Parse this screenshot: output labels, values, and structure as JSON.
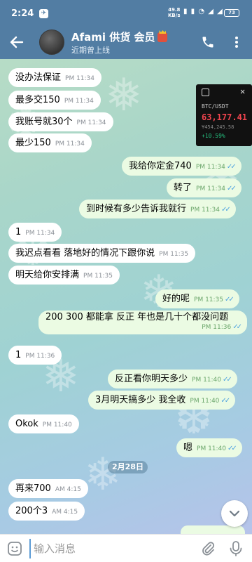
{
  "status_bar": {
    "time": "2:24",
    "telegram_badge": "✈",
    "speed_value": "49.8",
    "speed_unit": "KB/s",
    "signal_icons": "▮ ▮ ◔ ◢ ◢",
    "battery": "73"
  },
  "header": {
    "title": "Afami 供货 会员",
    "subtitle": "近期曾上线",
    "back_icon": "arrow-left",
    "call_icon": "phone",
    "menu_icon": "more-vertical"
  },
  "btc_widget": {
    "pair": "BTC/USDT",
    "price": "63,177.41",
    "local_price": "¥454,245.58",
    "change": "+10.59%",
    "close_label": "✕"
  },
  "messages": [
    {
      "text": "没办法保证",
      "time": "PM 11:34",
      "dir": "in"
    },
    {
      "text": "最多交150",
      "time": "PM 11:34",
      "dir": "in"
    },
    {
      "text": "我账号就30个",
      "time": "PM 11:34",
      "dir": "in"
    },
    {
      "text": "最少150",
      "time": "PM 11:34",
      "dir": "in"
    },
    {
      "text": "我给你定金740",
      "time": "PM 11:34",
      "dir": "out"
    },
    {
      "text": "转了",
      "time": "PM 11:34",
      "dir": "out"
    },
    {
      "text": "到时候有多少告诉我就行",
      "time": "PM 11:34",
      "dir": "out"
    },
    {
      "text": "1",
      "time": "PM 11:34",
      "dir": "in"
    },
    {
      "text": "我迟点看看 落地好的情况下跟你说",
      "time": "PM 11:35",
      "dir": "in"
    },
    {
      "text": "明天给你安排满",
      "time": "PM 11:35",
      "dir": "in"
    },
    {
      "text": "好的呢",
      "time": "PM 11:35",
      "dir": "out"
    },
    {
      "text": "200 300 都能拿 反正 年也是几十个都没问题",
      "time": "PM 11:36",
      "dir": "out"
    },
    {
      "text": "1",
      "time": "PM 11:36",
      "dir": "in"
    },
    {
      "text": "反正看你明天多少",
      "time": "PM 11:40",
      "dir": "out"
    },
    {
      "text": "3月明天搞多少 我全收",
      "time": "PM 11:40",
      "dir": "out"
    },
    {
      "text": "Okok",
      "time": "PM 11:40",
      "dir": "in"
    },
    {
      "text": "嗯",
      "time": "PM 11:40",
      "dir": "out"
    },
    {
      "text": "再来700",
      "time": "AM 4:15",
      "dir": "in"
    },
    {
      "text": "200个3",
      "time": "AM 4:15",
      "dir": "in"
    }
  ],
  "date_separator": "2月28日",
  "read_ticks": "✓✓",
  "input": {
    "placeholder": "输入消息",
    "value": ""
  },
  "colors": {
    "header_bg": "#527da3",
    "incoming_bubble": "#ffffff",
    "outgoing_bubble": "#ebfbe3",
    "read_tick": "#4fa3e0",
    "btc_price": "#f0444e",
    "btc_change": "#26c281"
  }
}
